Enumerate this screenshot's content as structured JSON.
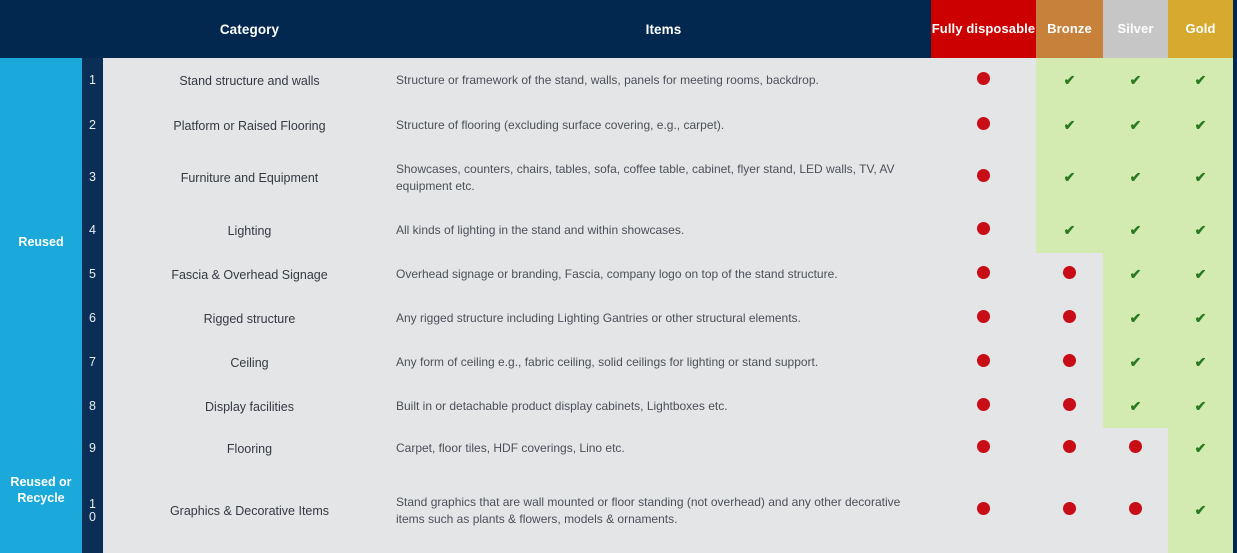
{
  "table": {
    "header": {
      "group_col": "",
      "num_col": "",
      "category": "Category",
      "items": "Items",
      "fully_disposable": "Fully disposable",
      "bronze": "Bronze",
      "silver": "Silver",
      "gold": "Gold"
    },
    "groups": [
      {
        "label": "Reused",
        "rowspan": 8
      },
      {
        "label": "Reused or Recycle",
        "rowspan": 2
      }
    ],
    "columns": [
      "#",
      "Category",
      "Items",
      "Fully disposable",
      "Bronze",
      "Silver",
      "Gold"
    ],
    "rows": [
      {
        "num": "1",
        "category": "Stand structure and walls",
        "items": "Structure or framework of the stand, walls, panels for meeting rooms, backdrop.",
        "fully_disposable": "dot",
        "bronze": "tick",
        "silver": "tick",
        "gold": "tick"
      },
      {
        "num": "2",
        "category": "Platform or Raised Flooring",
        "items": "Structure of flooring (excluding surface covering, e.g., carpet).",
        "fully_disposable": "dot",
        "bronze": "tick",
        "silver": "tick",
        "gold": "tick"
      },
      {
        "num": "3",
        "category": "Furniture and Equipment",
        "items": "Showcases, counters, chairs, tables, sofa, coffee table, cabinet, flyer stand, LED walls, TV, AV equipment etc.",
        "fully_disposable": "dot",
        "bronze": "tick",
        "silver": "tick",
        "gold": "tick"
      },
      {
        "num": "4",
        "category": "Lighting",
        "items": "All kinds of lighting in the stand and within showcases.",
        "fully_disposable": "dot",
        "bronze": "tick",
        "silver": "tick",
        "gold": "tick"
      },
      {
        "num": "5",
        "category": "Fascia & Overhead Signage",
        "items": "Overhead signage or branding, Fascia, company logo on top of the stand structure.",
        "fully_disposable": "dot",
        "bronze": "dot",
        "silver": "tick",
        "gold": "tick"
      },
      {
        "num": "6",
        "category": "Rigged structure",
        "items": "Any rigged structure including Lighting Gantries or other structural elements.",
        "fully_disposable": "dot",
        "bronze": "dot",
        "silver": "tick",
        "gold": "tick"
      },
      {
        "num": "7",
        "category": "Ceiling",
        "items": "Any form of ceiling e.g., fabric ceiling, solid ceilings for lighting or stand support.",
        "fully_disposable": "dot",
        "bronze": "dot",
        "silver": "tick",
        "gold": "tick"
      },
      {
        "num": "8",
        "category": "Display facilities",
        "items": "Built in or detachable product display cabinets, Lightboxes etc.",
        "fully_disposable": "dot",
        "bronze": "dot",
        "silver": "tick",
        "gold": "tick"
      },
      {
        "num": "9",
        "category": "Flooring",
        "items": "Carpet, floor tiles, HDF coverings, Lino etc.",
        "fully_disposable": "dot",
        "bronze": "dot",
        "silver": "dot",
        "gold": "tick"
      },
      {
        "num": "10",
        "category": "Graphics & Decorative Items",
        "items": "Stand graphics that are wall mounted or floor standing (not overhead) and any other decorative items such as plants & flowers, models & ornaments.",
        "fully_disposable": "dot",
        "bronze": "dot",
        "silver": "dot",
        "gold": "tick"
      }
    ],
    "legend": {
      "dot_meaning": "not-allowed-indicator",
      "tick_meaning": "allowed-indicator"
    }
  },
  "colors": {
    "header_navy": "#03284f",
    "group_blue": "#1ba9dc",
    "number_navy": "#0a2e55",
    "fully_disposable_red": "#cc0000",
    "bronze": "#c8813a",
    "silver": "#c6c6c6",
    "gold": "#d7a92e",
    "cell_gray": "#e4e5e7",
    "cell_green": "#d3eab0",
    "dot_red": "#c80d16",
    "tick_green": "#2a7a22"
  },
  "icons": {
    "dot": "●",
    "tick": "✔"
  }
}
